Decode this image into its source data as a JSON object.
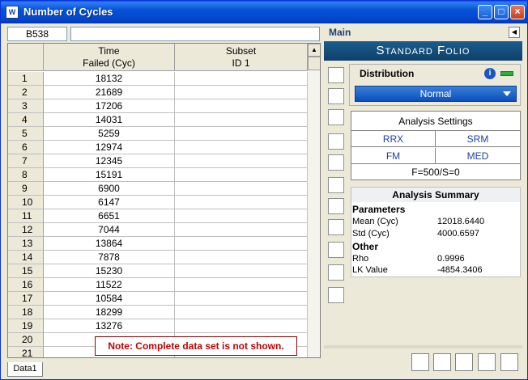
{
  "window": {
    "title": "Number of Cycles",
    "app_icon_letter": "W"
  },
  "cell_ref": "B538",
  "formula": "",
  "columns": [
    {
      "line1": "Time",
      "line2": "Failed (Cyc)"
    },
    {
      "line1": "Subset",
      "line2": "ID 1"
    }
  ],
  "rows": [
    {
      "n": "1",
      "a": "18132"
    },
    {
      "n": "2",
      "a": "21689"
    },
    {
      "n": "3",
      "a": "17206"
    },
    {
      "n": "4",
      "a": "14031"
    },
    {
      "n": "5",
      "a": "5259"
    },
    {
      "n": "6",
      "a": "12974"
    },
    {
      "n": "7",
      "a": "12345"
    },
    {
      "n": "8",
      "a": "15191"
    },
    {
      "n": "9",
      "a": "6900"
    },
    {
      "n": "10",
      "a": "6147"
    },
    {
      "n": "11",
      "a": "6651"
    },
    {
      "n": "12",
      "a": "7044"
    },
    {
      "n": "13",
      "a": "13864"
    },
    {
      "n": "14",
      "a": "7878"
    },
    {
      "n": "15",
      "a": "15230"
    },
    {
      "n": "16",
      "a": "11522"
    },
    {
      "n": "17",
      "a": "10584"
    },
    {
      "n": "18",
      "a": "18299"
    },
    {
      "n": "19",
      "a": "13276"
    },
    {
      "n": "20",
      "a": ""
    },
    {
      "n": "21",
      "a": ""
    }
  ],
  "note": "Note: Complete data set is not shown.",
  "sheet_tab": "Data1",
  "right_panel": {
    "header": "Main",
    "banner": "Standard Folio",
    "distribution_label": "Distribution",
    "distribution_value": "Normal",
    "settings_title": "Analysis Settings",
    "settings": [
      "RRX",
      "SRM",
      "FM",
      "MED"
    ],
    "settings_footer": "F=500/S=0",
    "summary_title": "Analysis Summary",
    "parameters_label": "Parameters",
    "mean_label": "Mean (Cyc)",
    "mean_value": "12018.6440",
    "std_label": "Std (Cyc)",
    "std_value": "4000.6597",
    "other_label": "Other",
    "rho_label": "Rho",
    "rho_value": "0.9996",
    "lk_label": "LK Value",
    "lk_value": "-4854.3406"
  },
  "colors": {
    "title_bar": "#0553d6",
    "banner": "#1b5d8e",
    "note_text": "#c00000",
    "select": "#0a4fbf"
  }
}
